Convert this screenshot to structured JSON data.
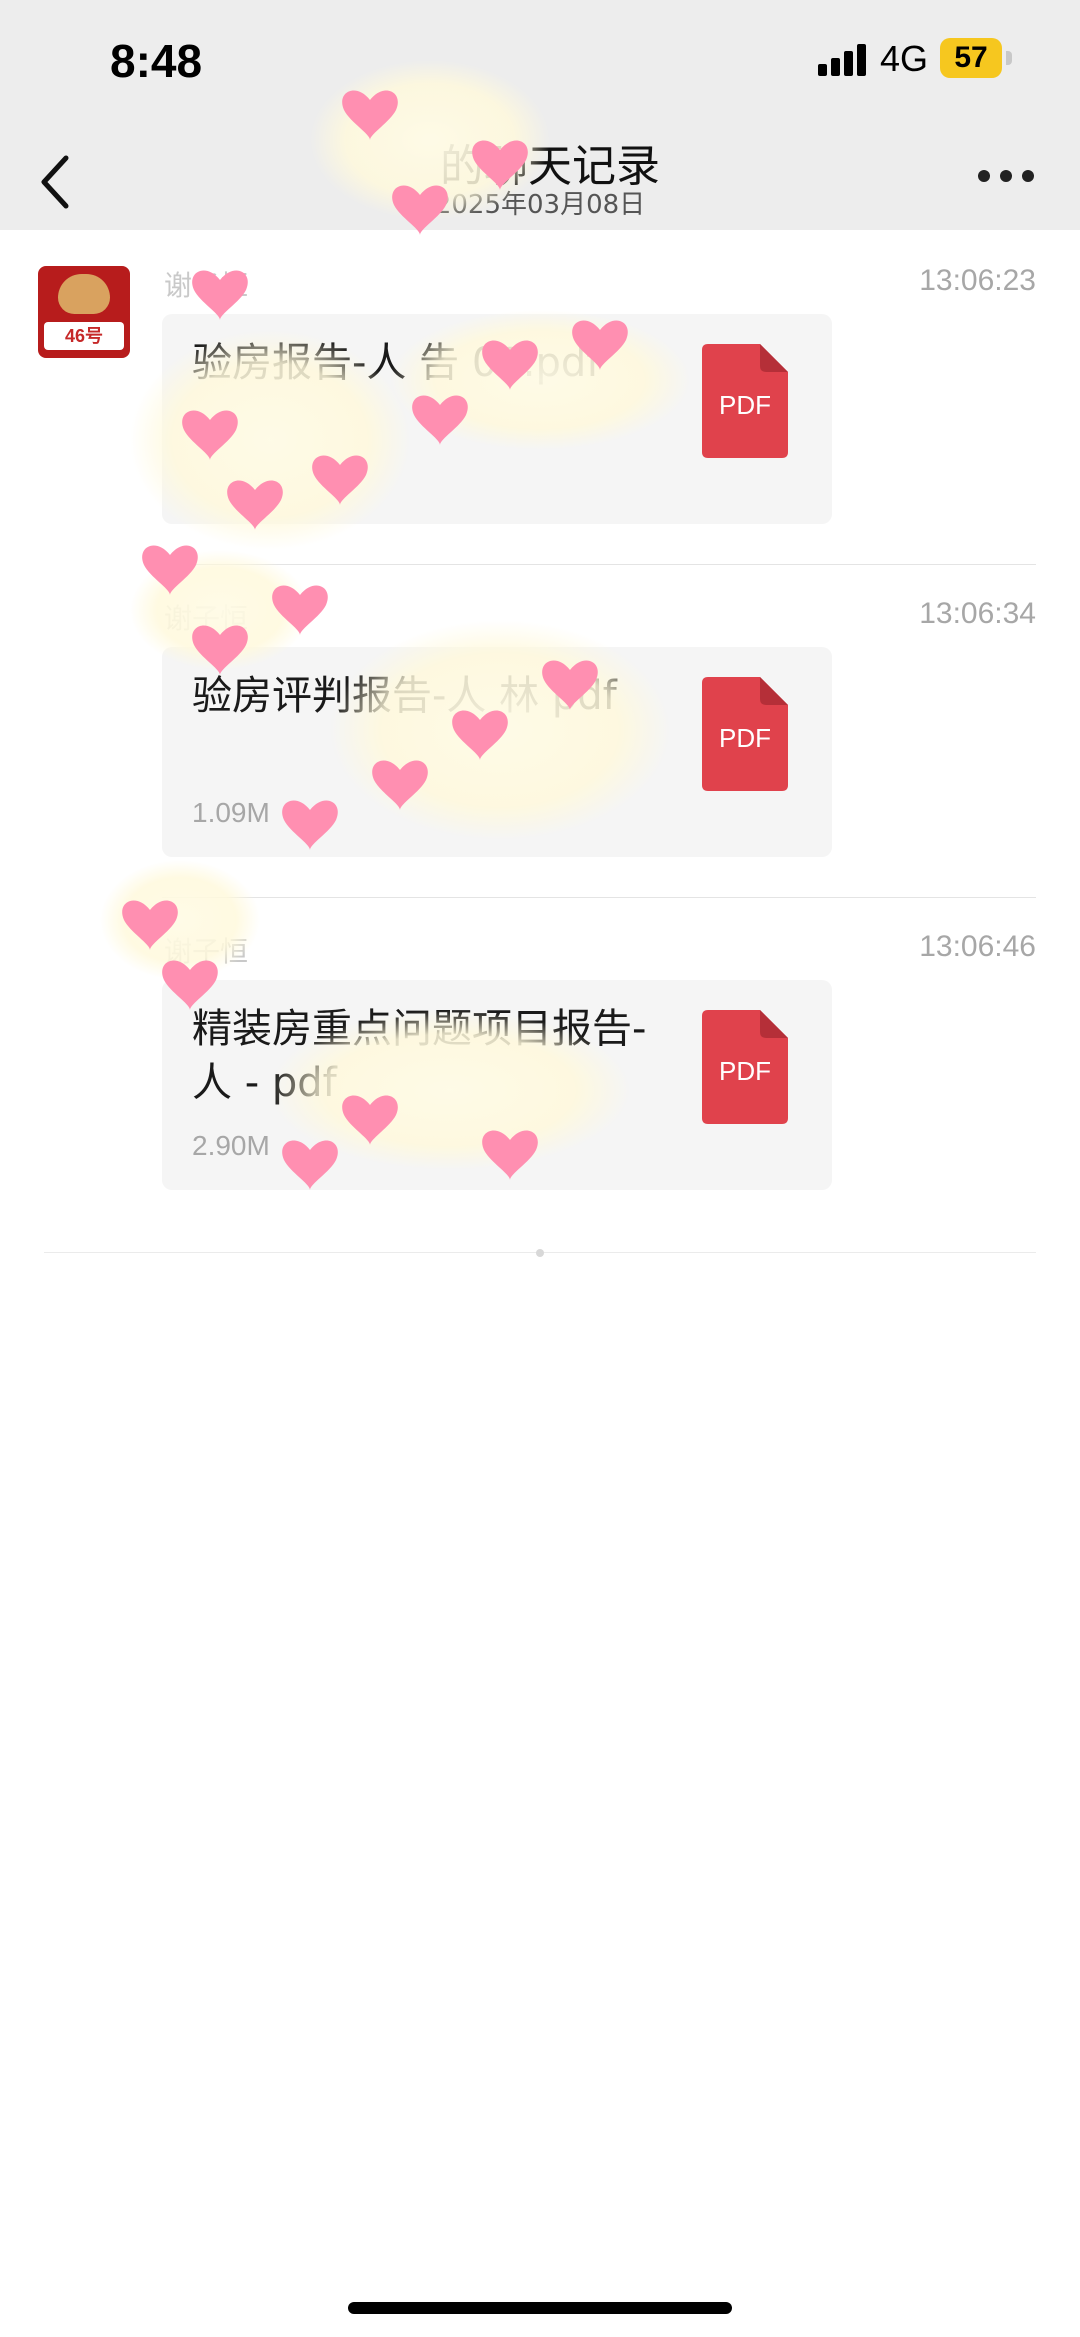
{
  "status_bar": {
    "time": "8:48",
    "network": "4G",
    "battery": "57"
  },
  "nav": {
    "title": "的聊天记录",
    "date": "2025年03月08日"
  },
  "avatar": {
    "badge": "46号"
  },
  "messages": [
    {
      "sender": "谢子恒",
      "time": "13:06:23",
      "file_name": "验房报告-人       告  01.pdf",
      "file_size": "",
      "file_icon_label": "PDF"
    },
    {
      "sender": "谢子恒",
      "time": "13:06:34",
      "file_name": "验房评判报告-人 林          pdf",
      "file_size": "1.09M",
      "file_icon_label": "PDF"
    },
    {
      "sender": "谢子恒",
      "time": "13:06:46",
      "file_name": "精装房重点问题项目报告-人      -      pdf",
      "file_size": "2.90M",
      "file_icon_label": "PDF"
    }
  ],
  "colors": {
    "pdf_red": "#e0424c",
    "heart_pink": "#ff8fb1",
    "background_gray": "#ededed"
  }
}
